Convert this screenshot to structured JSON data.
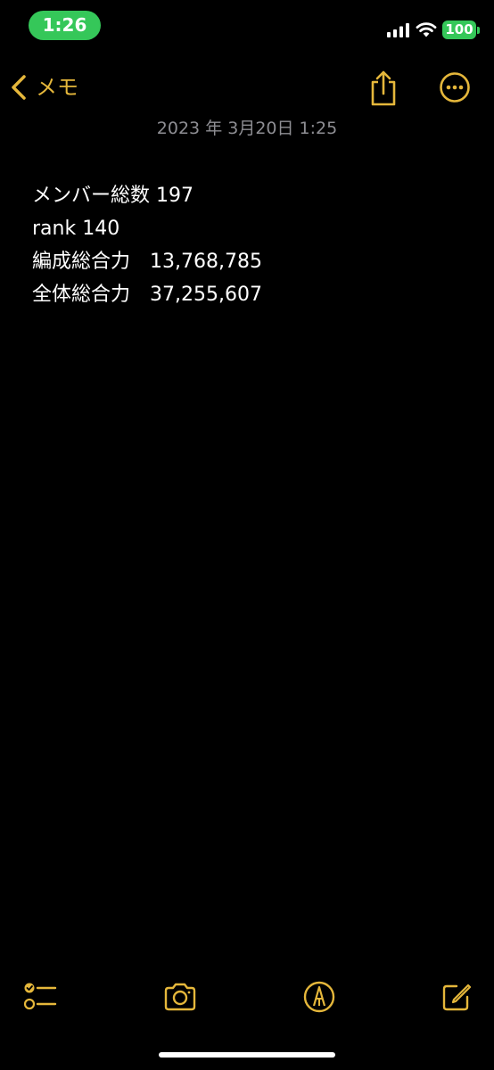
{
  "status_bar": {
    "time": "1:26",
    "battery": "100",
    "accent_color": "#35c759",
    "icons": [
      "signal-icon",
      "wifi-icon",
      "battery-icon"
    ]
  },
  "nav": {
    "back_label": "メモ",
    "accent_color": "#e5b73b",
    "icons": [
      "chevron-left-icon",
      "share-icon",
      "more-icon"
    ]
  },
  "note": {
    "date": "2023 年 3月20日 1:25",
    "lines": [
      "メンバー総数 197",
      "rank 140",
      "編成総合力　13,768,785",
      "全体総合力　37,255,607"
    ]
  },
  "toolbar": {
    "icons": [
      "checklist-icon",
      "camera-icon",
      "markup-icon",
      "compose-icon"
    ]
  }
}
